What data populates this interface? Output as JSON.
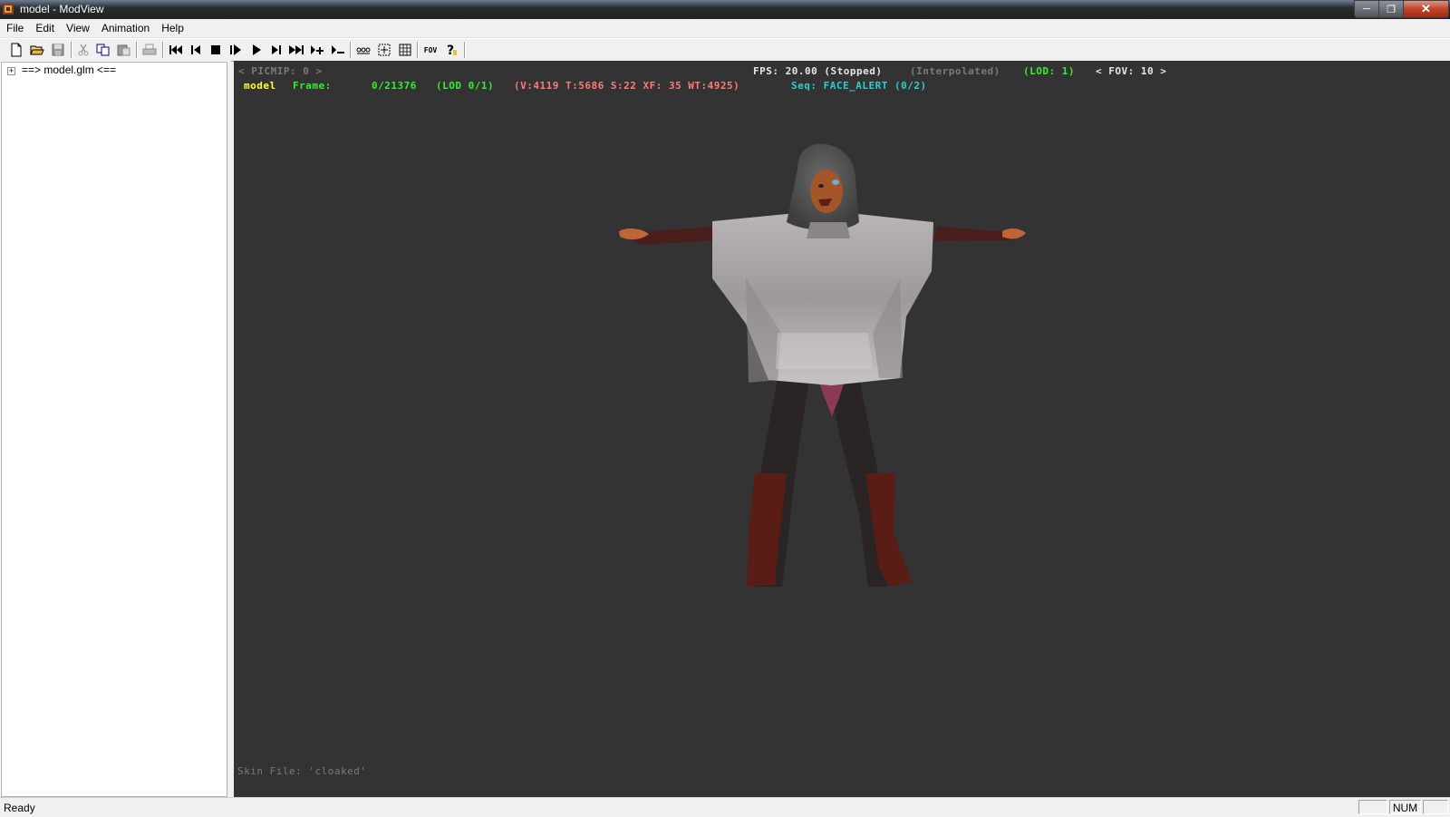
{
  "window": {
    "title": "model - ModView",
    "icon": "modview-app-icon",
    "controls": [
      "minimize",
      "maximize",
      "close"
    ]
  },
  "menu": [
    "File",
    "Edit",
    "View",
    "Animation",
    "Help"
  ],
  "toolbar": {
    "icons": [
      "new-file-icon",
      "open-folder-icon",
      "save-icon",
      "cut-icon",
      "copy-icon",
      "paste-icon",
      "print-icon",
      "rewind-icon",
      "step-back-icon",
      "stop-icon",
      "step-frame-icon",
      "play-icon",
      "step-forward-icon",
      "fast-forward-icon",
      "lod-up-icon",
      "lod-down-icon",
      "bones-icon",
      "bbox-icon",
      "texture-icon",
      "fov-icon",
      "help-icon"
    ],
    "fov_label": "FOV"
  },
  "tree": {
    "expander": "+",
    "root_label": "==> model.glm <=="
  },
  "hud": {
    "picmip": "< PICMIP: 0 >",
    "fps": "FPS: 20.00 (Stopped)",
    "interpolated": "(Interpolated)",
    "lod": "(LOD: 1)",
    "fov": "< FOV: 10 >",
    "model_name": "model",
    "frame_label": "Frame:",
    "frame_value": "0/21376",
    "lod_range": "(LOD 0/1)",
    "stats": "(V:4119 T:5686 S:22 XF: 35 WT:4925)",
    "sequence": "Seq: FACE_ALERT (0/2)",
    "skin_file": "Skin File: 'cloaked'"
  },
  "colors": {
    "viewport_bg": "#333333",
    "hud_white": "#e6e6e6",
    "hud_grey": "#7a7a7a",
    "hud_yellow": "#ffff33",
    "hud_green": "#33ee33",
    "hud_salmon": "#ff7a7a",
    "hud_cyan": "#33cccc"
  },
  "status": {
    "text": "Ready",
    "num": "NUM"
  }
}
